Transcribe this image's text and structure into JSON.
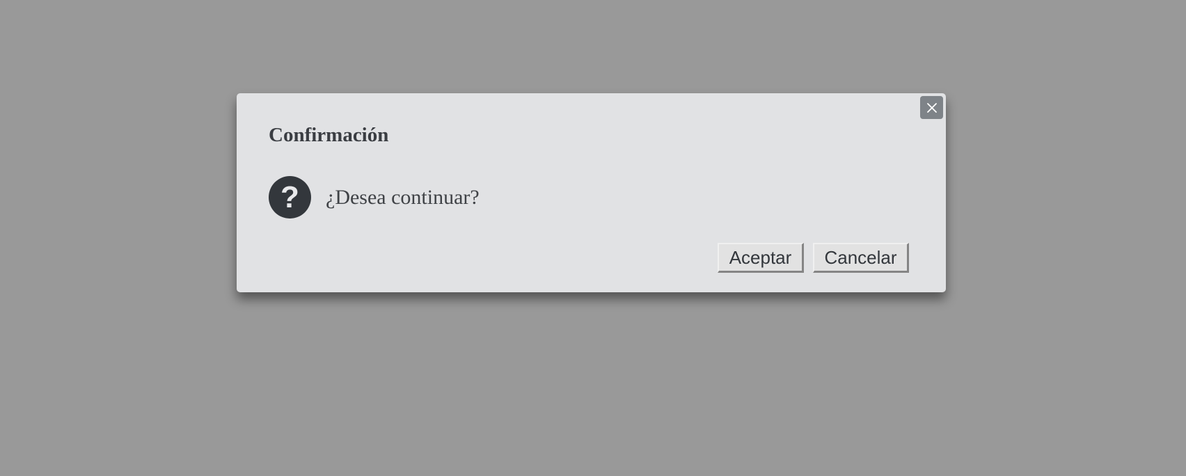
{
  "overlay": {
    "background_color": "#999999"
  },
  "dialog": {
    "title": "Confirmación",
    "message": "¿Desea continuar?",
    "icon": "question-icon",
    "icon_glyph": "?",
    "close_icon": "close-icon",
    "background_color": "#e1e2e4",
    "buttons": {
      "accept_label": "Aceptar",
      "cancel_label": "Cancelar"
    }
  }
}
